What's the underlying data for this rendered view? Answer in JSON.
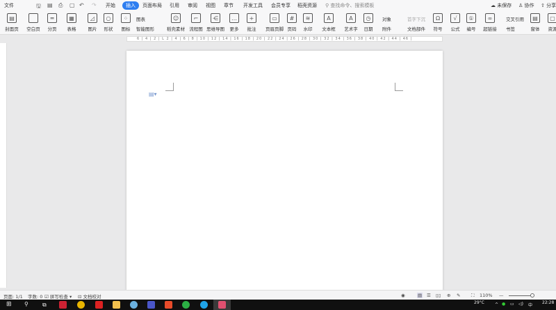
{
  "menubar": {
    "file": "文件",
    "tabs": [
      "开始",
      "插入",
      "页面布局",
      "引用",
      "审阅",
      "视图",
      "章节",
      "开发工具",
      "会员专享",
      "稻壳资源"
    ],
    "active_tab": "插入",
    "search_placeholder": "查找命令、搜索模板",
    "unsaved": "未保存",
    "collab": "协作",
    "share": "分享"
  },
  "ribbon": {
    "items": [
      {
        "label": "封面页",
        "icon": "cover-icon",
        "glyph": "▤"
      },
      {
        "label": "空白页",
        "icon": "blank-page-icon",
        "glyph": ""
      },
      {
        "label": "分页",
        "icon": "page-break-icon",
        "glyph": "═"
      },
      {
        "label": "表格",
        "icon": "table-icon",
        "glyph": "▦"
      },
      {
        "label": "图片",
        "icon": "picture-icon",
        "glyph": "◿"
      },
      {
        "label": "形状",
        "icon": "shape-icon",
        "glyph": "○"
      },
      {
        "label": "图标",
        "icon": "icons-icon",
        "glyph": "⁘"
      },
      {
        "label": "稻壳素材",
        "icon": "material-icon",
        "glyph": "☺"
      },
      {
        "label": "流程图",
        "icon": "flowchart-icon",
        "glyph": "⌐"
      },
      {
        "label": "思维导图",
        "icon": "mindmap-icon",
        "glyph": "⋲"
      },
      {
        "label": "更多",
        "icon": "more-icon",
        "glyph": "…"
      },
      {
        "label": "批注",
        "icon": "comment-icon",
        "glyph": "+"
      },
      {
        "label": "页眉页脚",
        "icon": "header-footer-icon",
        "glyph": "▭"
      },
      {
        "label": "页码",
        "icon": "page-number-icon",
        "glyph": "#"
      },
      {
        "label": "水印",
        "icon": "watermark-icon",
        "glyph": "≋"
      },
      {
        "label": "文本框",
        "icon": "textbox-icon",
        "glyph": "A"
      },
      {
        "label": "艺术字",
        "icon": "wordart-icon",
        "glyph": "A"
      },
      {
        "label": "日期",
        "icon": "date-icon",
        "glyph": "◷"
      },
      {
        "label": "符号",
        "icon": "symbol-icon",
        "glyph": "Ω"
      },
      {
        "label": "公式",
        "icon": "formula-icon",
        "glyph": "√"
      },
      {
        "label": "编号",
        "icon": "numbering-icon",
        "glyph": "①"
      },
      {
        "label": "超链接",
        "icon": "hyperlink-icon",
        "glyph": "∞"
      },
      {
        "label": "窗体",
        "icon": "form-icon",
        "glyph": "▤"
      },
      {
        "label": "资源",
        "icon": "resource-icon",
        "glyph": "▢"
      }
    ],
    "chart": "图表",
    "smart_art": "智能图形",
    "object": "对象",
    "attachment": "附件",
    "drop_cap": "首字下沉",
    "doc_parts": "文档部件",
    "cross_ref": "交叉引用",
    "bookmark": "书签"
  },
  "ruler_marks": "6 | 4 | 2 | L 2 | 4 | 6 | 8 | 10 | 12 | 14 | 16 | 18 | 20 | 22 | 24 | 26 | 28 | 30 | 32 | 34 | 36 | 38 | 40 | 42 | 44 | 46 |",
  "status": {
    "page": "页面: 1/1",
    "words": "字数: 0",
    "spell": "拼写检查",
    "proof": "文档校对",
    "zoom": "110%"
  },
  "taskbar": {
    "temp": "29°C",
    "time": "22:28",
    "ime": "中"
  }
}
